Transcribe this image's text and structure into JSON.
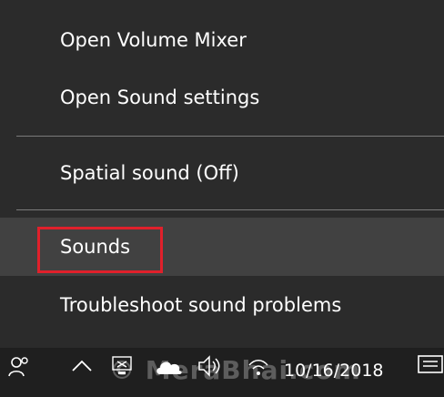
{
  "menu": {
    "items": [
      {
        "label": "Open Volume Mixer"
      },
      {
        "label": "Open Sound settings"
      },
      {
        "label": "Spatial sound (Off)"
      },
      {
        "label": "Sounds",
        "hovered": true,
        "highlighted": true
      },
      {
        "label": "Troubleshoot sound problems"
      }
    ]
  },
  "colors": {
    "menu_background": "#2b2b2b",
    "hover_background": "#414141",
    "highlight_border": "#e0202b",
    "taskbar_background": "#1f1f1f"
  },
  "taskbar": {
    "icons": [
      "people-icon",
      "chevron-up-icon",
      "network-icon",
      "onedrive-icon",
      "volume-icon",
      "wifi-icon",
      "action-center-icon"
    ],
    "clock": "10/16/2018",
    "watermark": "© MeraBhai.com"
  }
}
